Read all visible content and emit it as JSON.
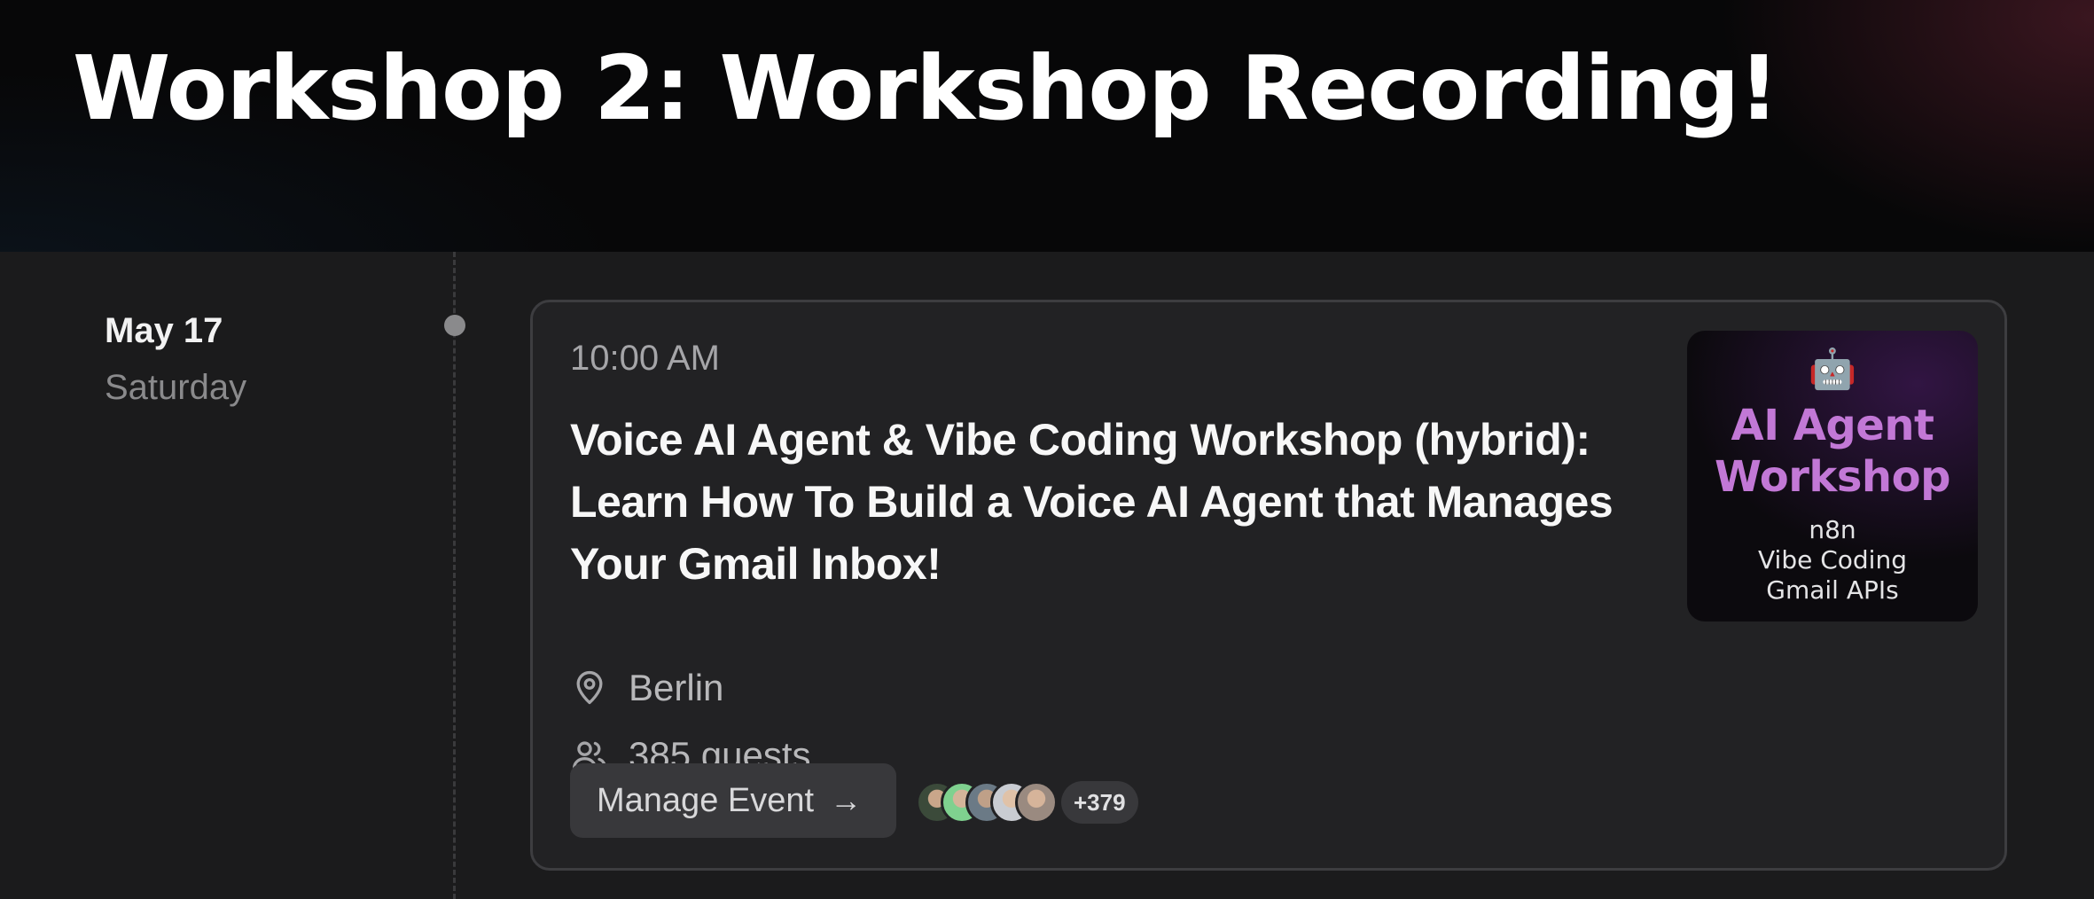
{
  "header": {
    "title": "Workshop 2: Workshop Recording!"
  },
  "schedule": {
    "date": "May 17",
    "weekday": "Saturday"
  },
  "event": {
    "time": "10:00 AM",
    "title": "Voice AI Agent & Vibe Coding Workshop (hybrid): Learn How To Build a Voice AI Agent that Manages Your Gmail Inbox!",
    "location": "Berlin",
    "location_icon": "map-pin-icon",
    "guests": "385 guests",
    "guests_icon": "users-icon",
    "manage_label": "Manage Event",
    "manage_arrow": "→",
    "more_guests": "+379",
    "thumbnail": {
      "emoji": "🤖",
      "title_lines": [
        "AI Agent",
        "Workshop"
      ],
      "sub_lines": [
        "n8n",
        "Vibe Coding",
        "Gmail APIs"
      ]
    }
  },
  "colors": {
    "page_bg": "#1b1b1c",
    "banner_bg": "#070708",
    "card_bg": "#222224",
    "card_border": "#3d3d40",
    "thumbnail_title": "#c278d6"
  }
}
